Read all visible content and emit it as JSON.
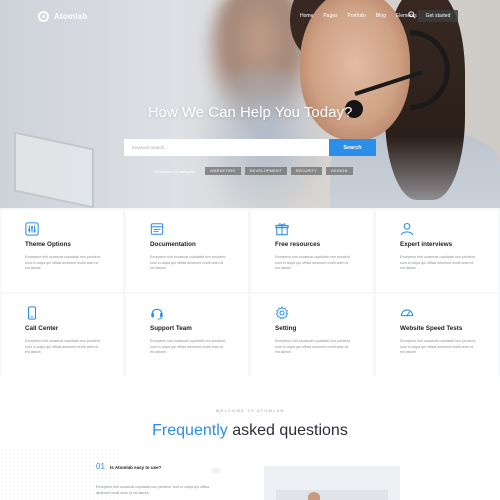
{
  "nav": {
    "logo": "Atomlab",
    "menu": [
      "Home",
      "Pages",
      "Portfolio",
      "Blog",
      "Elements"
    ],
    "cta_label": "Get started"
  },
  "hero": {
    "title": "How We Can Help You Today?",
    "search": {
      "placeholder": "Keyword search...",
      "button_label": "Search"
    },
    "browse_label": "Or browse by category:",
    "chips": [
      "MARKETING",
      "DEVELOPMENT",
      "SECURITY",
      "DESIGN"
    ]
  },
  "cards": [
    {
      "icon": "sliders-icon",
      "title": "Theme Options",
      "desc": "Excepteur sint occaecat cupidatat non proident, sunt in culpa qui officia deserunt mollit anim id est labore."
    },
    {
      "icon": "documentation-icon",
      "title": "Documentation",
      "desc": "Excepteur sint occaecat cupidatat non proident, sunt in culpa qui officia deserunt mollit anim id est labore."
    },
    {
      "icon": "gift-icon",
      "title": "Free resources",
      "desc": "Excepteur sint occaecat cupidatat non proident, sunt in culpa qui officia deserunt mollit anim id est labore."
    },
    {
      "icon": "user-icon",
      "title": "Expert interviews",
      "desc": "Excepteur sint occaecat cupidatat non proident, sunt in culpa qui officia deserunt mollit anim id est labore."
    },
    {
      "icon": "phone-icon",
      "title": "Call Center",
      "desc": "Excepteur sint occaecat cupidatat non proident, sunt in culpa qui officia deserunt mollit anim id est labore."
    },
    {
      "icon": "headset-icon",
      "title": "Support Team",
      "desc": "Excepteur sint occaecat cupidatat non proident, sunt in culpa qui officia deserunt mollit anim id est labore."
    },
    {
      "icon": "gear-icon",
      "title": "Setting",
      "desc": "Excepteur sint occaecat cupidatat non proident, sunt in culpa qui officia deserunt mollit anim id est labore."
    },
    {
      "icon": "speedometer-icon",
      "title": "Website Speed Tests",
      "desc": "Excepteur sint occaecat cupidatat non proident, sunt in culpa qui officia deserunt mollit anim id est labore."
    }
  ],
  "faq": {
    "eyebrow": "WELCOME TO ATOMLAB",
    "title_accent": "Frequently",
    "title_rest": " asked questions",
    "item": {
      "number": "01",
      "question": "Is Atomlab easy to use?",
      "answer": "Excepteur sint occaecat cupidatat non proident, sunt in culpa qui officia deserunt mollit anim id est labore."
    }
  },
  "colors": {
    "accent": "#2b8ee8",
    "chip": "#6e6e6e",
    "cta": "#3c3c3c"
  }
}
